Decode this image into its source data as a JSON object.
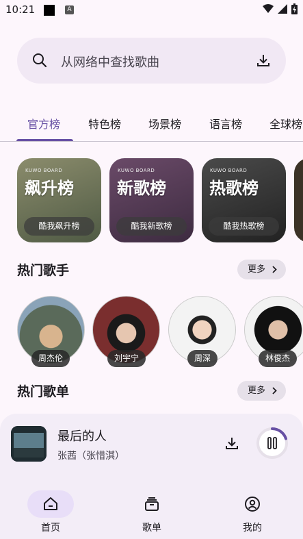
{
  "status": {
    "time": "10:21",
    "badge": "A"
  },
  "search": {
    "placeholder": "从网络中查找歌曲"
  },
  "tabs": [
    "官方榜",
    "特色榜",
    "场景榜",
    "语言榜",
    "全球榜"
  ],
  "charts": [
    {
      "brand": "KUWO BOARD",
      "title": "飙升榜",
      "label": "酷我飙升榜",
      "color": "#6b6f52"
    },
    {
      "brand": "KUWO BOARD",
      "title": "新歌榜",
      "label": "酷我新歌榜",
      "color": "#5a3f55"
    },
    {
      "brand": "KUWO BOARD",
      "title": "热歌榜",
      "label": "酷我热歌榜",
      "color": "#3a3a3a"
    }
  ],
  "sections": {
    "hot_artists": {
      "title": "热门歌手",
      "more": "更多"
    },
    "hot_playlists": {
      "title": "热门歌单",
      "more": "更多"
    }
  },
  "artists": [
    {
      "name": "周杰伦",
      "color": "#8aa0b4"
    },
    {
      "name": "刘宇宁",
      "color": "#7a2e2e"
    },
    {
      "name": "周深",
      "color": "#d9d9d9"
    },
    {
      "name": "林俊杰",
      "color": "#2a2a2a"
    }
  ],
  "player": {
    "title": "最后的人",
    "artist": "张茜（张惜淇）",
    "progress": 0.2
  },
  "nav": [
    {
      "label": "首页",
      "icon": "home-icon",
      "active": true
    },
    {
      "label": "歌单",
      "icon": "playlist-icon",
      "active": false
    },
    {
      "label": "我的",
      "icon": "profile-icon",
      "active": false
    }
  ]
}
